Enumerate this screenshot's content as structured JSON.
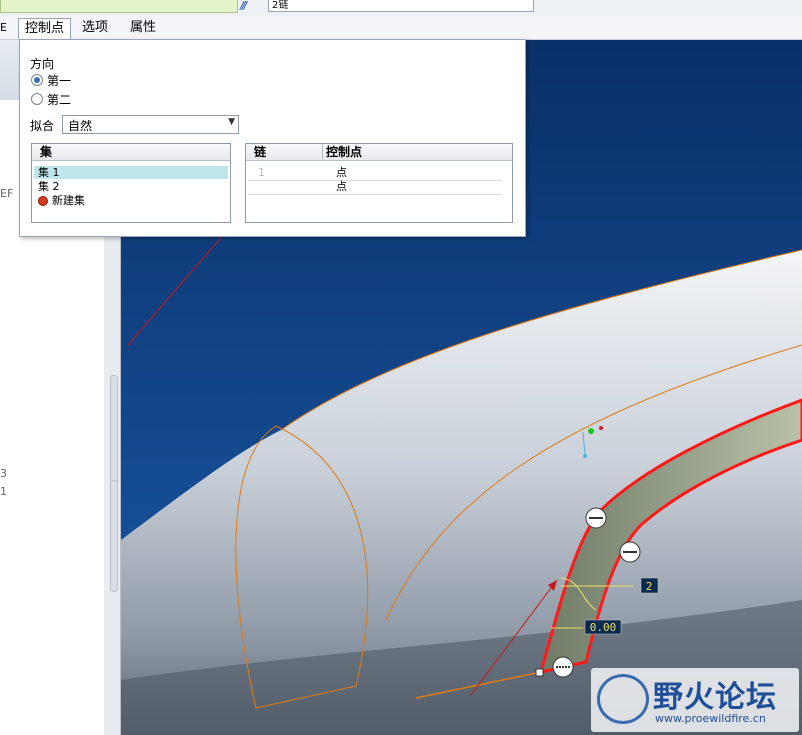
{
  "topbar": {
    "chain_field_value": "2链",
    "chain_icon": "chain-icon"
  },
  "tabs": [
    {
      "label": "■",
      "active": false
    },
    {
      "label": "控制点",
      "active": true
    },
    {
      "label": "选项",
      "active": false
    },
    {
      "label": "属性",
      "active": false
    }
  ],
  "left_panel": {
    "fragment_ef": "EF",
    "fragment_3": "3",
    "fragment_1": "1"
  },
  "popup": {
    "direction_label": "方向",
    "radio_first": "第一",
    "radio_second": "第二",
    "fit_label": "拟合",
    "fit_value": "自然",
    "sets": {
      "header": "集",
      "items": [
        "集 1",
        "集 2"
      ],
      "new_set": "新建集"
    },
    "chains": {
      "col_chain": "链",
      "col_control_point": "控制点",
      "rows": [
        {
          "chain": "1",
          "point": "点"
        },
        {
          "chain": "",
          "point": "点"
        }
      ]
    }
  },
  "viewport": {
    "dim_label_2": "2",
    "dim_label_000": "0.00"
  },
  "watermark": {
    "title": "野火论坛",
    "url": "www.proewildfire.cn"
  },
  "colors": {
    "accent_selected": "#bfe6ea",
    "model_blue": "#0c3a78",
    "highlight_red": "#ff1a1a",
    "curve_orange": "#e07a12"
  }
}
